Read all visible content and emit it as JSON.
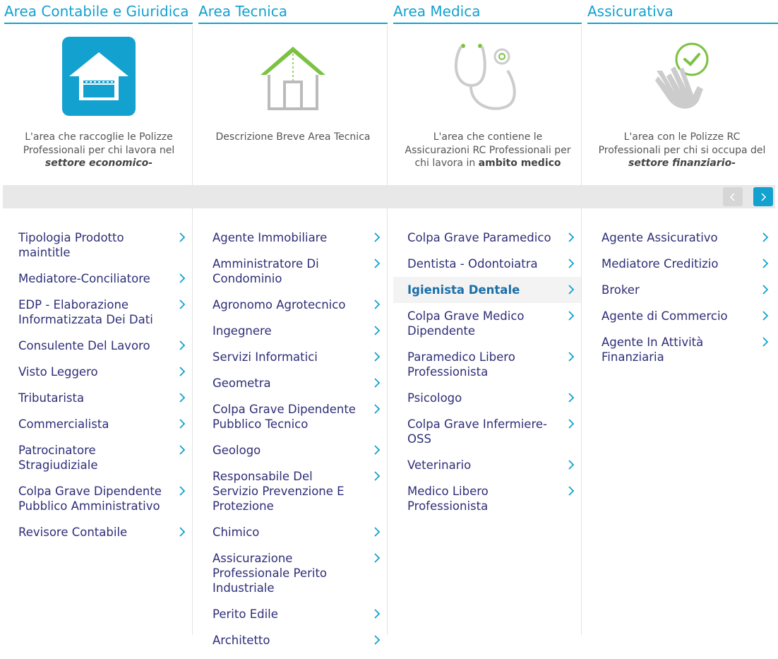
{
  "columns": [
    {
      "title": "Area Contabile e Giuridica",
      "icon": "house-badge-icon",
      "desc_plain": "L'area che raccoglie le Polizze Professionali per chi lavora nel",
      "desc_bold": "settore economico-",
      "items": [
        "Tipologia Prodotto maintitle",
        "Mediatore-Conciliatore",
        "EDP - Elaborazione Informatizzata Dei Dati",
        "Consulente Del Lavoro",
        "Visto Leggero",
        "Tributarista",
        "Commercialista",
        "Patrocinatore Stragiudiziale",
        "Colpa Grave Dipendente Pubblico Amministrativo",
        "Revisore Contabile"
      ]
    },
    {
      "title": "Area Tecnica",
      "icon": "house-outline-icon",
      "desc_plain": "Descrizione Breve Area Tecnica",
      "desc_bold": "",
      "items": [
        "Agente Immobiliare",
        "Amministratore Di Condominio",
        "Agronomo Agrotecnico",
        "Ingegnere",
        "Servizi Informatici",
        "Geometra",
        "Colpa Grave Dipendente Pubblico Tecnico",
        "Geologo",
        "Responsabile Del Servizio Prevenzione E Protezione",
        "Chimico",
        "Assicurazione Professionale Perito Industriale",
        "Perito Edile",
        "Architetto"
      ]
    },
    {
      "title": "Area Medica",
      "icon": "stethoscope-icon",
      "desc_plain": "L'area che contiene le Assicurazioni RC Professionali per chi lavora in",
      "desc_bold": "ambito medico",
      "items": [
        "Colpa Grave Paramedico",
        "Dentista - Odontoiatra",
        "Igienista Dentale",
        "Colpa Grave Medico Dipendente",
        "Paramedico Libero Professionista",
        "Psicologo",
        "Colpa Grave Infermiere-OSS",
        "Veterinario",
        "Medico Libero Professionista"
      ],
      "highlighted": "Igienista Dentale"
    },
    {
      "title": "Assicurativa",
      "icon": "hand-check-icon",
      "desc_plain": "L'area con le Polizze RC Professionali per chi si occupa del",
      "desc_bold": "settore finanziario-",
      "items": [
        "Agente Assicurativo",
        "Mediatore Creditizio",
        "Broker",
        "Agente di Commercio",
        "Agente In Attività Finanziaria"
      ]
    }
  ],
  "nav": {
    "prev_icon": "chevron-left-icon",
    "next_icon": "chevron-right-icon"
  },
  "colors": {
    "accent": "#13a1cf",
    "text": "#2e2e78",
    "green": "#7cc242"
  }
}
